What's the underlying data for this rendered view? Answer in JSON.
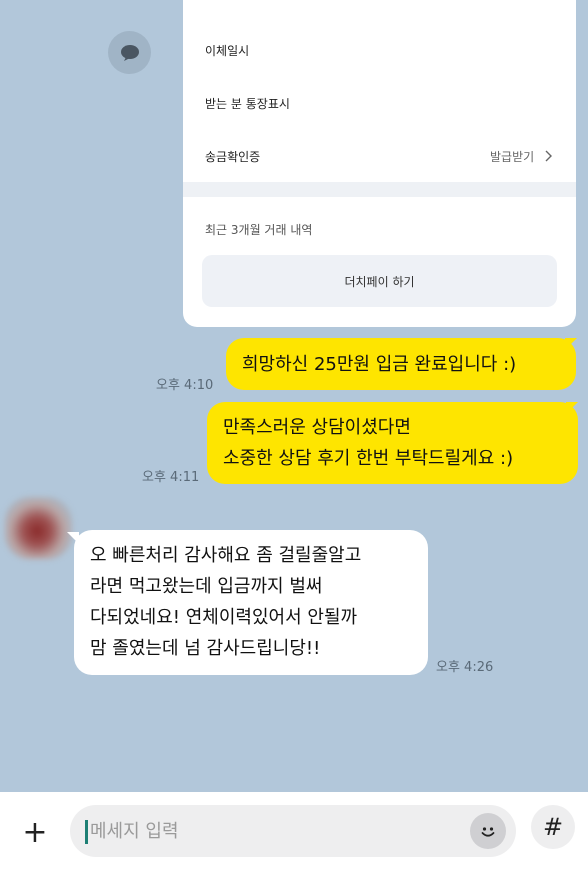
{
  "transfer_card": {
    "rows": [
      {
        "label": "이체일시"
      },
      {
        "label": "받는 분 통장표시"
      },
      {
        "label": "송금확인증",
        "action": "발급받기",
        "action_icon": "chevron-right-icon"
      }
    ],
    "recent_label": "최근 3개월 거래 내역",
    "dutch_pay_label": "더치페이 하기"
  },
  "messages": [
    {
      "sender": "me",
      "text": "희망하신 25만원 입금 완료입니다 :)",
      "time": "오후 4:10"
    },
    {
      "sender": "me",
      "lines": [
        "만족스러운 상담이셨다면",
        "소중한 상담 후기 한번 부탁드릴게요 :)"
      ],
      "time": "오후 4:11"
    },
    {
      "sender": "other",
      "lines": [
        "오 빠른처리 감사해요 좀 걸릴줄알고",
        "라면 먹고왔는데 입금까지 벌써",
        "다되었네요! 연체이력있어서 안될까",
        "맘 졸였는데 넘 감사드립니당!!"
      ],
      "time": "오후 4:26"
    }
  ],
  "input_bar": {
    "placeholder": "메세지 입력",
    "plus_label": "+",
    "hash_label": "#",
    "emoji_icon": "emoji-icon"
  },
  "colors": {
    "background": "#b2c7da",
    "my_bubble": "#fee500",
    "other_bubble": "#ffffff"
  }
}
